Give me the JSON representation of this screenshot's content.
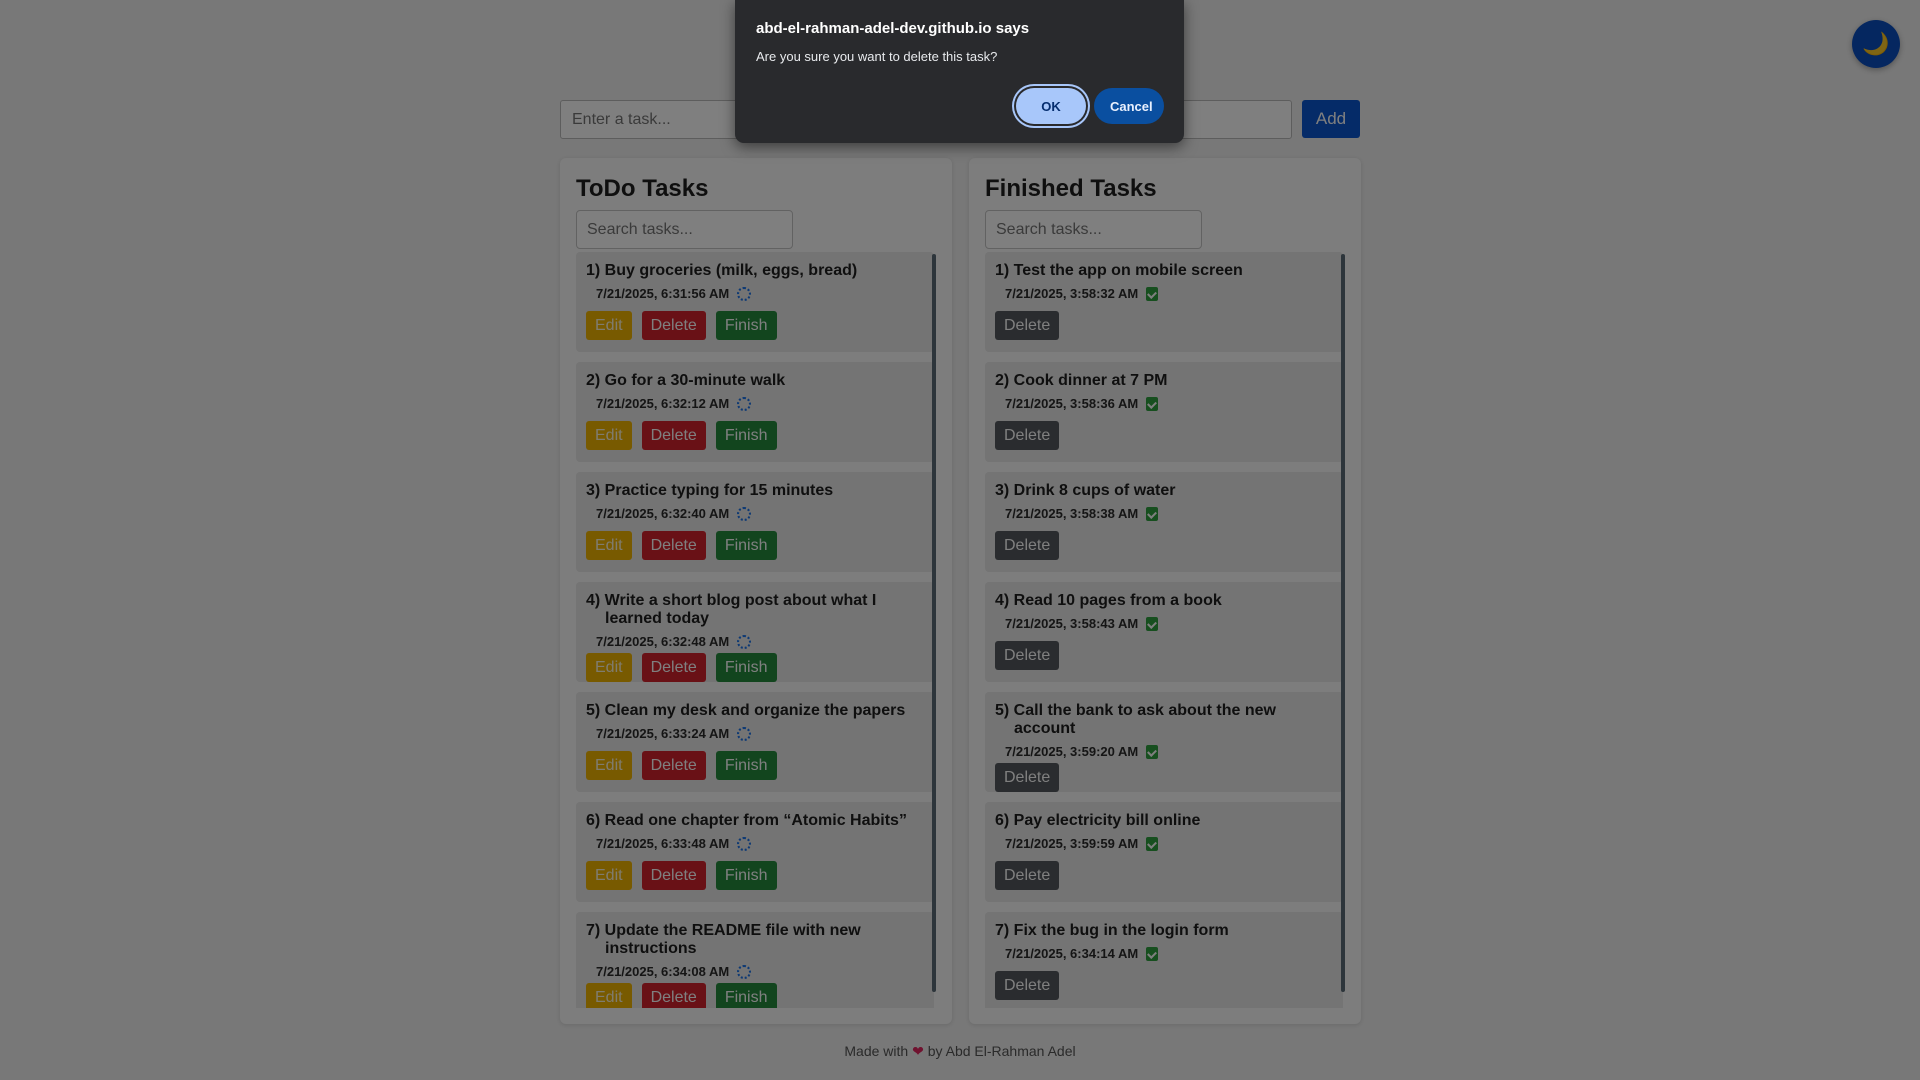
{
  "theme_toggle": {
    "icon": "moon-icon",
    "glyph": "🌙"
  },
  "input": {
    "placeholder": "Enter a task...",
    "add_label": "Add"
  },
  "todo": {
    "title": "ToDo Tasks",
    "search_placeholder": "Search tasks...",
    "tasks": [
      {
        "title": "1) Buy groceries (milk, eggs, bread)",
        "time": "7/21/2025, 6:31:56 AM"
      },
      {
        "title": "2) Go for a 30-minute walk",
        "time": "7/21/2025, 6:32:12 AM"
      },
      {
        "title": "3) Practice typing for 15 minutes",
        "time": "7/21/2025, 6:32:40 AM"
      },
      {
        "title": "4) Write a short blog post about what I learned today",
        "time": "7/21/2025, 6:32:48 AM"
      },
      {
        "title": "5) Clean my desk and organize the papers",
        "time": "7/21/2025, 6:33:24 AM"
      },
      {
        "title": "6) Read one chapter from “Atomic Habits”",
        "time": "7/21/2025, 6:33:48 AM"
      },
      {
        "title": "7) Update the README file with new instructions",
        "time": "7/21/2025, 6:34:08 AM"
      }
    ],
    "edit_label": "Edit",
    "delete_label": "Delete",
    "finish_label": "Finish"
  },
  "finished": {
    "title": "Finished Tasks",
    "search_placeholder": "Search tasks...",
    "tasks": [
      {
        "title": "1) Test the app on mobile screen",
        "time": "7/21/2025, 3:58:32 AM"
      },
      {
        "title": "2) Cook dinner at 7 PM",
        "time": "7/21/2025, 3:58:36 AM"
      },
      {
        "title": "3) Drink 8 cups of water",
        "time": "7/21/2025, 3:58:38 AM"
      },
      {
        "title": "4) Read 10 pages from a book",
        "time": "7/21/2025, 3:58:43 AM"
      },
      {
        "title": "5) Call the bank to ask about the new account",
        "time": "7/21/2025, 3:59:20 AM"
      },
      {
        "title": "6) Pay electricity bill online",
        "time": "7/21/2025, 3:59:59 AM"
      },
      {
        "title": "7) Fix the bug in the login form",
        "time": "7/21/2025, 6:34:14 AM"
      }
    ],
    "delete_label": "Delete"
  },
  "footer": {
    "prefix": "Made with",
    "heart": "❤",
    "suffix": "by Abd El-Rahman Adel"
  },
  "dialog": {
    "title": "abd-el-rahman-adel-dev.github.io says",
    "message": "Are you sure you want to delete this task?",
    "ok_label": "OK",
    "cancel_label": "Cancel"
  },
  "colors": {
    "accent": "#0b57d0",
    "edit": "#f0b400",
    "delete": "#d2222d",
    "finish": "#248a3d",
    "finished_delete": "#55595e"
  }
}
